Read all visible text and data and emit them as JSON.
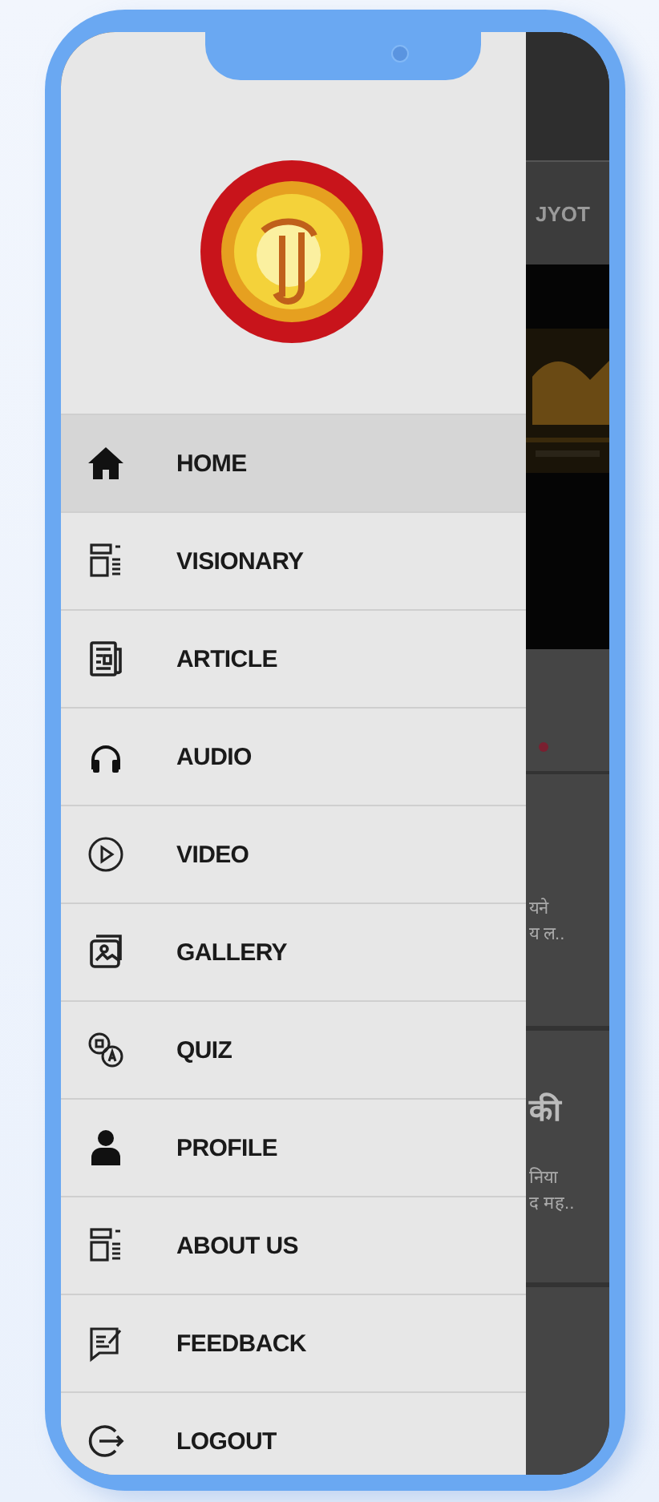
{
  "drawer": {
    "items": [
      {
        "label": "HOME",
        "selected": true
      },
      {
        "label": "VISIONARY",
        "selected": false
      },
      {
        "label": "ARTICLE",
        "selected": false
      },
      {
        "label": "AUDIO",
        "selected": false
      },
      {
        "label": "VIDEO",
        "selected": false
      },
      {
        "label": "GALLERY",
        "selected": false
      },
      {
        "label": "QUIZ",
        "selected": false
      },
      {
        "label": "PROFILE",
        "selected": false
      },
      {
        "label": "ABOUT US",
        "selected": false
      },
      {
        "label": "FEEDBACK",
        "selected": false
      },
      {
        "label": "LOGOUT",
        "selected": false
      }
    ]
  },
  "background": {
    "tab": "JYOT",
    "cards": [
      {
        "lines": [
          "यने",
          "य ल.."
        ]
      },
      {
        "title": "की",
        "lines": [
          "निया",
          "द मह.."
        ]
      }
    ]
  }
}
